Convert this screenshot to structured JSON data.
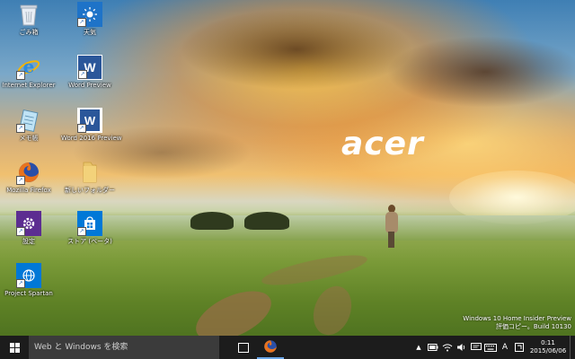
{
  "wallpaper": {
    "brand": "acer"
  },
  "desktop_icons": [
    {
      "id": "recycle-bin",
      "label": "ごみ箱",
      "icon": "recycle-bin-icon",
      "shortcut": false
    },
    {
      "id": "weather",
      "label": "天気",
      "icon": "weather-sun-icon",
      "shortcut": true
    },
    {
      "id": "internet-explorer",
      "label": "Internet Explorer",
      "icon": "internet-explorer-icon",
      "shortcut": true
    },
    {
      "id": "word-preview",
      "label": "Word Preview",
      "icon": "word-icon",
      "shortcut": true
    },
    {
      "id": "notepad",
      "label": "メモ帳",
      "icon": "notepad-icon",
      "shortcut": true
    },
    {
      "id": "word-2016-preview",
      "label": "Word 2016 Preview",
      "icon": "word-icon",
      "shortcut": true
    },
    {
      "id": "firefox",
      "label": "Mozilla Firefox",
      "icon": "firefox-icon",
      "shortcut": true
    },
    {
      "id": "new-folder",
      "label": "新しいフォルダー",
      "icon": "folder-icon",
      "shortcut": false
    },
    {
      "id": "settings",
      "label": "設定",
      "icon": "gear-icon",
      "shortcut": true
    },
    {
      "id": "store-beta",
      "label": "ストア (ベータ)",
      "icon": "store-icon",
      "shortcut": true
    },
    {
      "id": "project-spartan",
      "label": "Project Spartan",
      "icon": "globe-icon",
      "shortcut": true
    }
  ],
  "watermark": {
    "line1": "Windows 10 Home Insider Preview",
    "line2": "評価コピー。Build 10130"
  },
  "taskbar": {
    "search_placeholder": "Web と Windows を検索",
    "pinned": [
      {
        "label": "Mozilla Firefox",
        "icon": "firefox-icon",
        "active": true
      }
    ],
    "tray": {
      "ime_mode": "A",
      "time": "0:11",
      "date": "2015/06/06"
    }
  },
  "colors": {
    "taskbar_bg": "#1c1c1c",
    "search_bg": "#3b3b3b",
    "active_indicator": "#6aa6e8",
    "word_blue": "#2b579a",
    "settings_purple": "#5c2d91",
    "store_blue": "#0078d7"
  }
}
